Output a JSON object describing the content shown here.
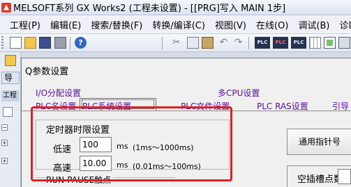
{
  "window": {
    "title": "MELSOFT系列 GX Works2 (工程未设置) - [[PRG]写入 MAIN 1步]"
  },
  "menubar": {
    "items": [
      "工程(P)",
      "编辑(E)",
      "搜索/替换(F)",
      "转换/编译(C)",
      "视图(V)",
      "在线(O)",
      "调试(B)",
      "诊断("
    ]
  },
  "toolbar": {
    "icons": [
      "new-file-icon",
      "open-folder-icon",
      "save-icon",
      "print-icon",
      "help-icon",
      "cut-icon",
      "copy-icon",
      "paste-icon",
      "undo-icon",
      "redo-icon",
      "plc-read-icon",
      "plc-write-icon",
      "plc-verify-icon",
      "grid-icon",
      "monitor-icon",
      "download-icon"
    ]
  },
  "left_panel": {
    "tab_label": "导",
    "section_label": "工程"
  },
  "dialog": {
    "title": "Q参数设置",
    "tabs_row1": [
      "I/O分配设置",
      "多CPU设置"
    ],
    "tabs_row2": [
      "PLC名设置",
      "PLC系统设置",
      "PLC文件设置",
      "PLC RAS设置",
      "引导"
    ],
    "active_tab": "PLC系统设置",
    "timer_group": {
      "label": "定时器时限设置",
      "low_speed": {
        "label": "低速",
        "value": "100",
        "unit": "ms",
        "range": "(1ms～1000ms)"
      },
      "high_speed": {
        "label": "高速",
        "value": "10.00",
        "unit": "ms",
        "range": "(0.01ms～100ms)"
      }
    },
    "run_pause_group": {
      "label": "RUN-PAUSE触点"
    },
    "common_pointer_label": "通用指针号",
    "empty_slot_label": "空插槽点数"
  },
  "colors": {
    "tab_text": "#5a0ca3",
    "highlight": "#e02020"
  }
}
